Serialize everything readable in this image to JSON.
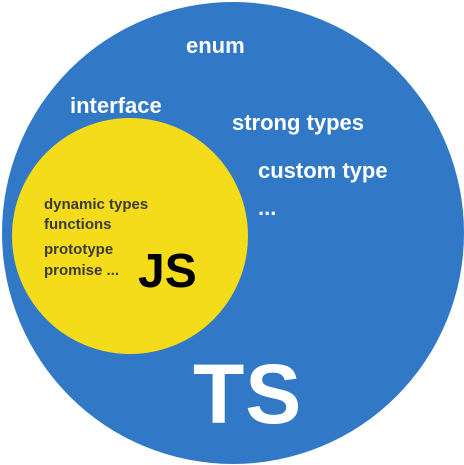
{
  "colors": {
    "ts_circle": "#3178c6",
    "js_circle": "#f5dc1a",
    "ts_text": "#ffffff",
    "js_text": "#3a3a3a",
    "js_logo": "#000000"
  },
  "ts": {
    "features": [
      "enum",
      "interface",
      "strong types",
      "custom type",
      "..."
    ],
    "logo": "TS"
  },
  "js": {
    "features": [
      "dynamic types",
      "functions",
      "prototype",
      "promise ..."
    ],
    "logo": "JS"
  }
}
